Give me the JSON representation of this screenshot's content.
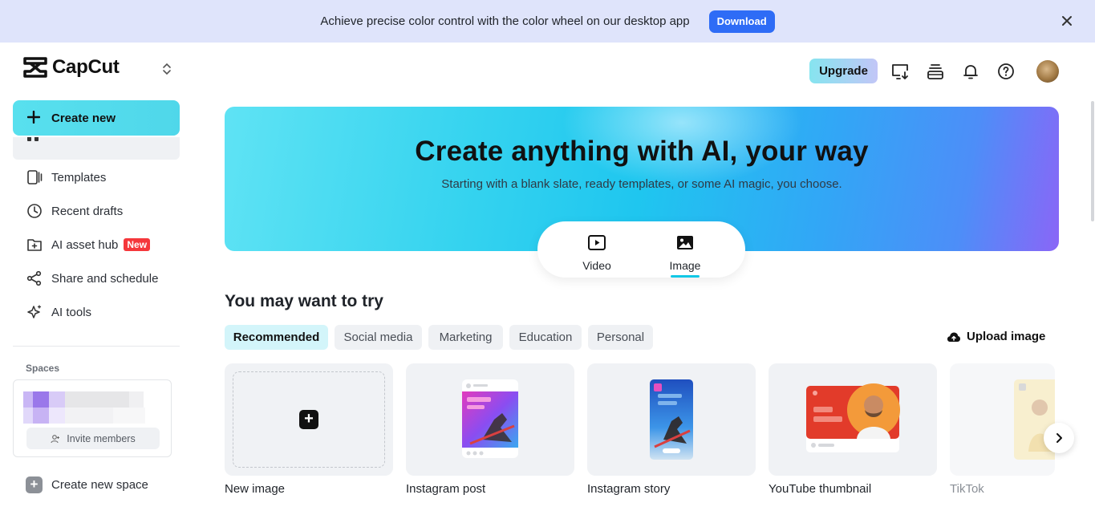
{
  "banner": {
    "text": "Achieve precise color control with the color wheel on our desktop app",
    "button": "Download",
    "close_icon": "close-icon"
  },
  "sidebar": {
    "logo": "CapCut",
    "create_new": "Create new",
    "items": [
      {
        "label": "Templates",
        "icon": "templates-icon"
      },
      {
        "label": "Recent drafts",
        "icon": "clock-icon"
      },
      {
        "label": "AI asset hub",
        "icon": "asset-hub-icon",
        "badge": "New"
      },
      {
        "label": "Share and schedule",
        "icon": "share-icon"
      },
      {
        "label": "AI tools",
        "icon": "sparkle-icon"
      }
    ],
    "spaces_label": "Spaces",
    "invite_members": "Invite members",
    "create_new_space": "Create new space"
  },
  "header": {
    "upgrade": "Upgrade",
    "icons": [
      "desktop-download-icon",
      "layers-icon",
      "bell-icon",
      "help-icon",
      "avatar"
    ]
  },
  "hero": {
    "title": "Create anything with AI, your way",
    "subtitle": "Starting with a blank slate, ready templates, or some AI magic, you choose.",
    "modes": [
      {
        "label": "Video",
        "icon": "video-icon"
      },
      {
        "label": "Image",
        "icon": "image-icon",
        "selected": true
      }
    ]
  },
  "section": {
    "title": "You may want to try",
    "tabs": [
      {
        "label": "Recommended",
        "active": true
      },
      {
        "label": "Social media"
      },
      {
        "label": "Marketing"
      },
      {
        "label": "Education"
      },
      {
        "label": "Personal"
      }
    ],
    "upload": "Upload image",
    "cards": [
      {
        "label": "New image"
      },
      {
        "label": "Instagram post"
      },
      {
        "label": "Instagram story"
      },
      {
        "label": "YouTube thumbnail"
      },
      {
        "label": "TikTok"
      }
    ]
  },
  "colors": {
    "accent": "#2e6cf6",
    "cyan": "#12c8e6",
    "badge_red": "#f5373b"
  }
}
